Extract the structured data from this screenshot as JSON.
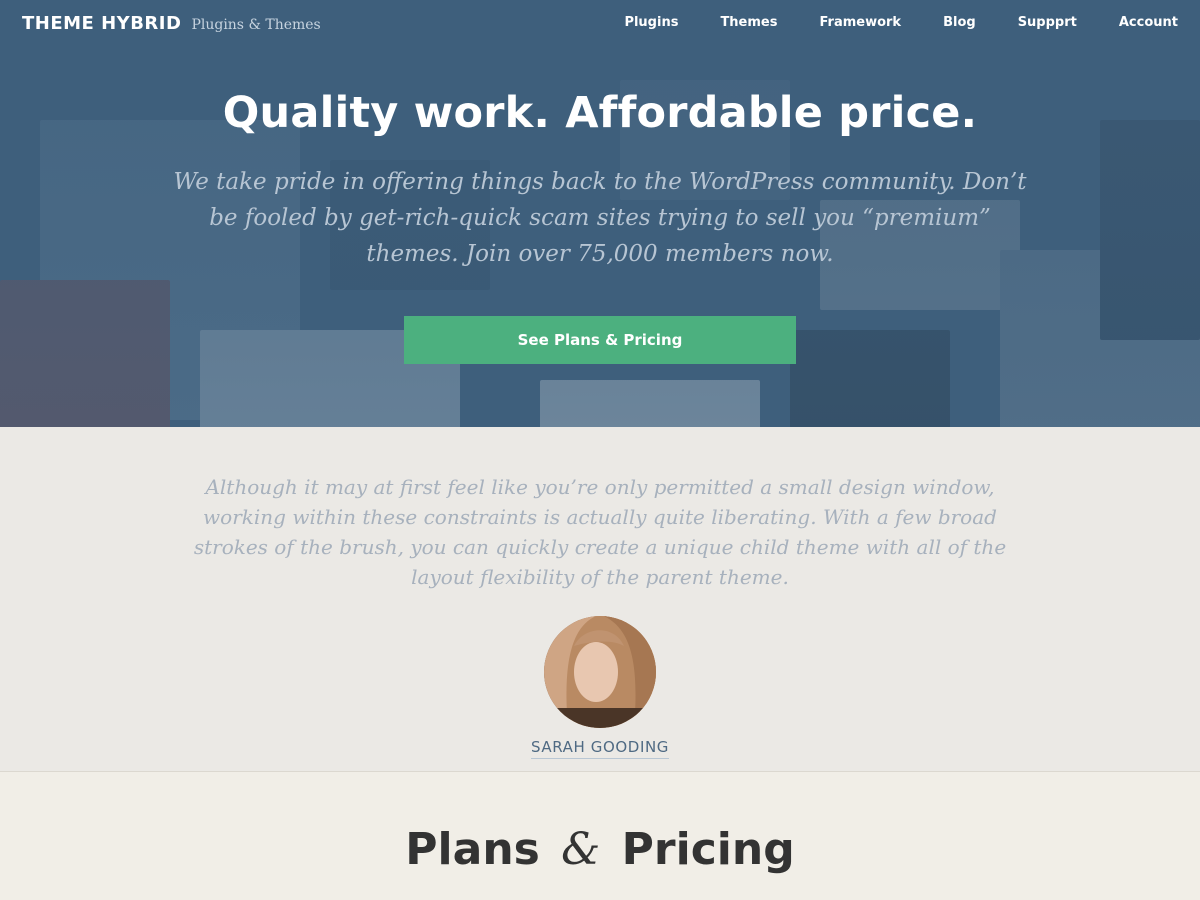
{
  "header": {
    "brand_name": "THEME HYBRID",
    "brand_tagline": "Plugins & Themes",
    "nav": [
      {
        "label": "Plugins"
      },
      {
        "label": "Themes"
      },
      {
        "label": "Framework"
      },
      {
        "label": "Blog"
      },
      {
        "label": "Suppprt"
      },
      {
        "label": "Account"
      }
    ]
  },
  "hero": {
    "title": "Quality work. Affordable price.",
    "text": "We take pride in offering things back to the WordPress community. Don’t be fooled by get-rich-quick scam sites trying to sell you “premium” themes. Join over 75,000 members now.",
    "cta_label": "See Plans & Pricing"
  },
  "testimonial": {
    "quote": "Although it may at first feel like you’re only permitted a small design window, working within these constraints is actually quite liberating. With a few broad strokes of the brush, you can quickly create a unique child theme with all of the layout flexibility of the parent theme.",
    "author": "SARAH GOODING"
  },
  "pricing": {
    "title_part1": "Plans",
    "title_amp": "&",
    "title_part2": "Pricing"
  },
  "colors": {
    "hero_overlay": "#3e5f7c",
    "cta": "#4cb07f",
    "testimonial_bg": "#ebe9e5",
    "pricing_bg": "#f1eee7",
    "author_link": "#4f6a83"
  }
}
